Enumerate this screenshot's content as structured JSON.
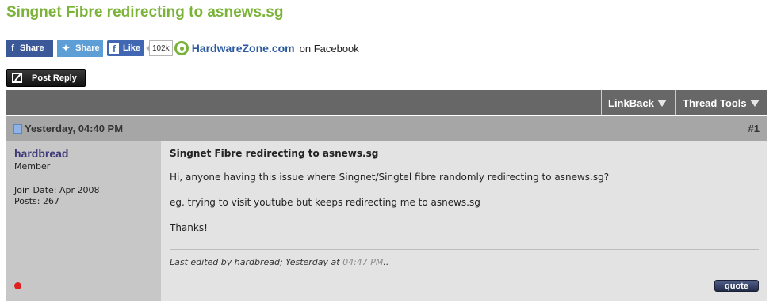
{
  "thread": {
    "title": "Singnet Fibre redirecting to asnews.sg"
  },
  "social": {
    "fb_share": "Share",
    "tw_share": "Share",
    "fb_like": "Like",
    "like_count": "102k",
    "site_name": "HardwareZone.com",
    "on_facebook": "on Facebook"
  },
  "post_reply_label": "Post Reply",
  "toolbar": {
    "linkback": "LinkBack",
    "thread_tools": "Thread Tools"
  },
  "post": {
    "date": "Yesterday, 04:40 PM",
    "number": "#1",
    "username": "hardbread",
    "user_title": "Member",
    "join_date": "Join Date: Apr 2008",
    "posts": "Posts: 267",
    "title": "Singnet Fibre redirecting to asnews.sg",
    "body": [
      "Hi, anyone having this issue where Singnet/Singtel fibre randomly redirecting to asnews.sg?",
      "eg. trying to visit youtube but keeps redirecting me to asnews.sg",
      "Thanks!"
    ],
    "edited_prefix": "Last edited by hardbread; Yesterday at ",
    "edited_time": "04:47 PM",
    "edited_suffix": "..",
    "quote_label": "quote",
    "online_status_color": "#e02020"
  },
  "colors": {
    "title_green": "#7ab338",
    "toolbar_bg": "#676767",
    "post_head_bg": "#a6a6a6",
    "userinfo_bg": "#c7c7c7",
    "postbody_bg": "#e3e3e3",
    "fb_blue": "#3b5998",
    "tw_blue": "#5e9ed6"
  },
  "icons": [
    "facebook-icon",
    "twitter-icon",
    "facebook-like-icon",
    "hardwarezone-logo",
    "post-reply-icon",
    "dropdown-triangle-icon",
    "post-icon",
    "online-status-icon"
  ]
}
